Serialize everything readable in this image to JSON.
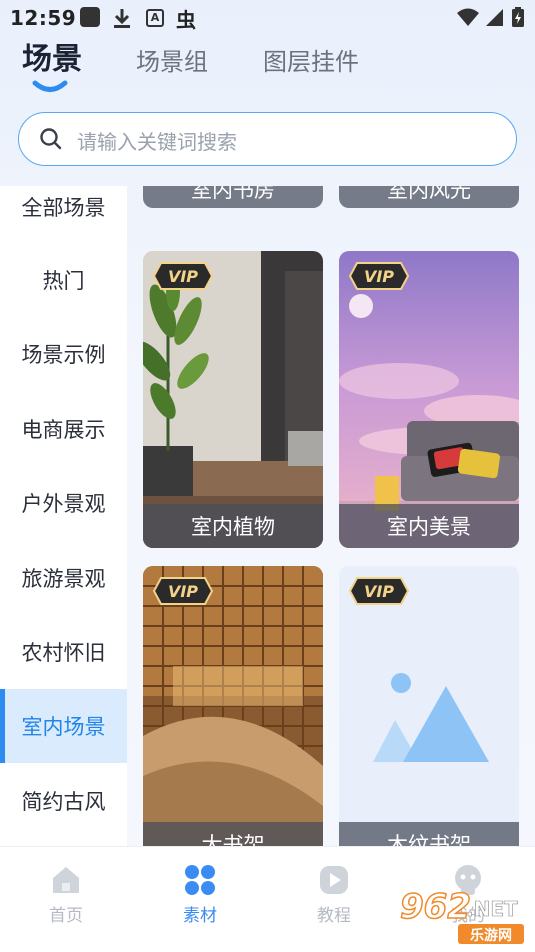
{
  "status_bar": {
    "time": "12:59",
    "a_icon_letter": "A",
    "bug_glyph": "虫"
  },
  "top_tabs": [
    {
      "label": "场景",
      "active": true
    },
    {
      "label": "场景组",
      "active": false
    },
    {
      "label": "图层挂件",
      "active": false
    }
  ],
  "search": {
    "placeholder": "请输入关键词搜索"
  },
  "sidebar": {
    "items": [
      {
        "label": "全部场景"
      },
      {
        "label": "热门"
      },
      {
        "label": "场景示例"
      },
      {
        "label": "电商展示"
      },
      {
        "label": "户外景观"
      },
      {
        "label": "旅游景观"
      },
      {
        "label": "农村怀旧"
      },
      {
        "label": "室内场景",
        "active": true
      },
      {
        "label": "简约古风"
      }
    ]
  },
  "cards": [
    {
      "label": "室内书房"
    },
    {
      "label": "室内风光"
    },
    {
      "label": "室内植物",
      "badge": "VIP"
    },
    {
      "label": "室内美景",
      "badge": "VIP"
    },
    {
      "label": "大书架",
      "badge": "VIP"
    },
    {
      "label": "木纹书架",
      "badge": "VIP"
    }
  ],
  "bottom_nav": [
    {
      "label": "首页",
      "icon": "home-icon"
    },
    {
      "label": "素材",
      "icon": "grid-dots-icon",
      "active": true
    },
    {
      "label": "教程",
      "icon": "play-icon"
    },
    {
      "label": "我的",
      "icon": "smiley-icon"
    }
  ],
  "watermark": {
    "brand": "962",
    "suffix": ".NET",
    "sub": "乐游网"
  },
  "colors": {
    "accent": "#2e8cf0",
    "active_sidebar_bg": "#d9ebfd",
    "vip_gold": "#f3d28a"
  }
}
